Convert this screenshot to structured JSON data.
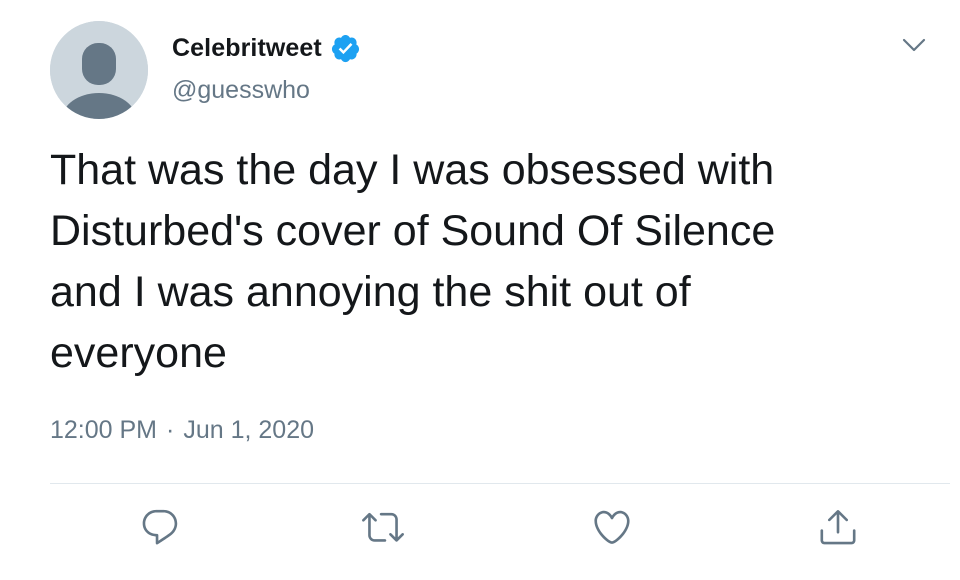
{
  "user": {
    "display_name": "Celebritweet",
    "handle": "@guesswho",
    "verified": true
  },
  "tweet": {
    "text": "That was the day I was obsessed with\nDisturbed's cover of Sound Of Silence\nand I was annoying the shit out of\neveryone",
    "time": "12:00 PM",
    "separator": "·",
    "date": "Jun 1, 2020"
  },
  "icons": {
    "avatar": "default-avatar-icon",
    "verified": "verified-badge-icon",
    "menu": "chevron-down-icon",
    "reply": "reply-icon",
    "retweet": "retweet-icon",
    "like": "heart-icon",
    "share": "share-icon"
  },
  "colors": {
    "text": "#14171a",
    "secondary": "#657786",
    "verified": "#1da1f2",
    "avatar_bg": "#ccd6dd",
    "avatar_fg": "#657786",
    "divider": "#e1e8ed"
  }
}
